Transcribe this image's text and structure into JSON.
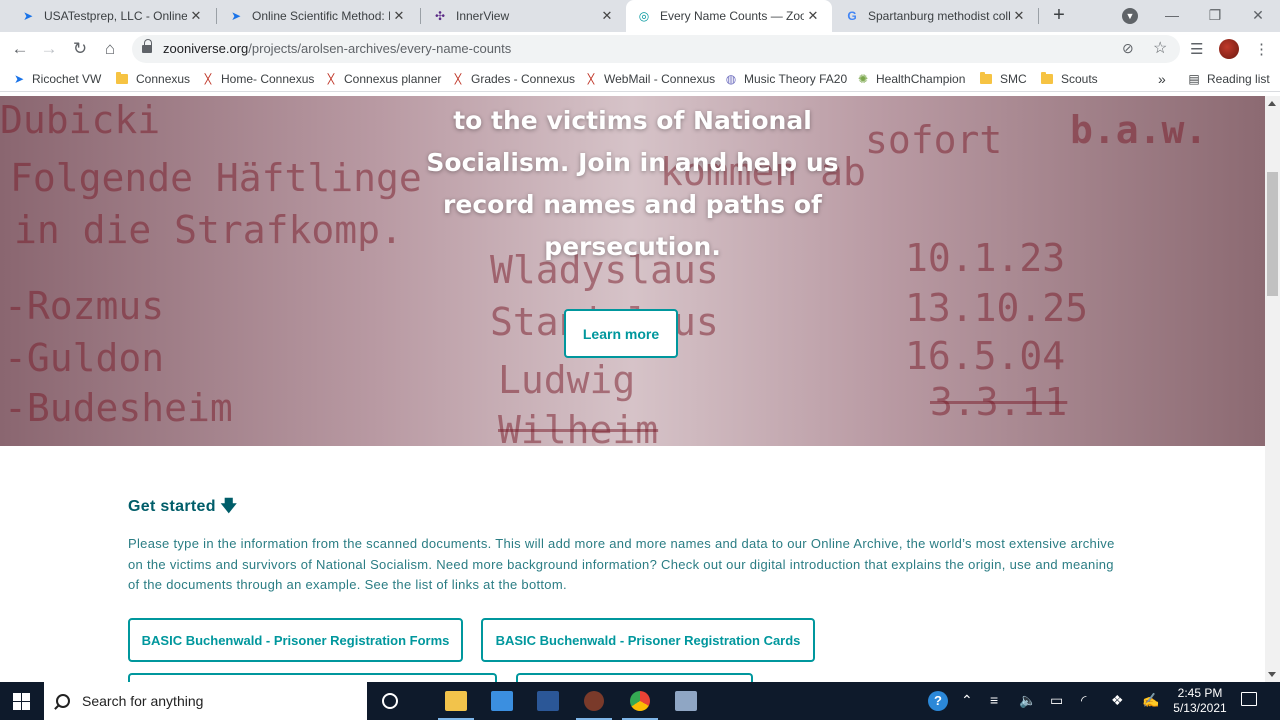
{
  "browser": {
    "tabs": [
      {
        "title": "USATestprep, LLC - Online State",
        "favicon": "cursor-icon"
      },
      {
        "title": "Online Scientific Method: Hypoth",
        "favicon": "cursor-icon"
      },
      {
        "title": "InnerView",
        "favicon": "innerview-icon"
      },
      {
        "title": "Every Name Counts — Zooniverse",
        "favicon": "zooniverse-icon"
      },
      {
        "title": "Spartanburg methodist college",
        "favicon": "google-icon"
      }
    ],
    "url_domain": "zooniverse.org",
    "url_path": "/projects/arolsen-archives/every-name-counts"
  },
  "bookmarks": [
    {
      "label": "Ricochet VW",
      "icon": "cursor-icon"
    },
    {
      "label": "Connexus",
      "icon": "folder-icon"
    },
    {
      "label": "Home- Connexus",
      "icon": "connexus-icon"
    },
    {
      "label": "Connexus planner",
      "icon": "connexus-icon"
    },
    {
      "label": "Grades - Connexus",
      "icon": "connexus-icon"
    },
    {
      "label": "WebMail - Connexus",
      "icon": "connexus-icon"
    },
    {
      "label": "Music Theory FA20",
      "icon": "globe-icon"
    },
    {
      "label": "HealthChampion",
      "icon": "gear-icon"
    },
    {
      "label": "SMC",
      "icon": "folder-icon"
    },
    {
      "label": "Scouts",
      "icon": "folder-icon"
    }
  ],
  "reading_list": "Reading list",
  "more_bookmarks": "»",
  "hero": {
    "line1": "to the victims of National",
    "line2": "Socialism. Join in and help us",
    "line3": "record names and paths of",
    "line4": "persecution.",
    "learn_more": "Learn more",
    "scan_text": {
      "a": "Dubicki",
      "b": "Folgende Häftlinge",
      "c": "in die Strafkomp.",
      "d": "-Rozmus",
      "e": "-Guldon",
      "f": "-Budesheim",
      "g": "kommen ab",
      "h": "sofort",
      "i": "b.a.w.",
      "j": "Wladyslaus",
      "k": "Stanislaus",
      "l": "Ludwig",
      "m": "Wilheim",
      "n": "10.1.23",
      "o": "13.10.25",
      "p": "16.5.04",
      "q": "3.3.11"
    }
  },
  "get_started": {
    "heading": "Get started",
    "arrow": "🡇",
    "text": "Please type in the information from the scanned documents. This will add more and more names and data to our Online Archive, the world’s most extensive archive on the victims and survivors of National Socialism. Need more background information? Check out our digital introduction that explains the origin, use and meaning of the documents through an example. See the list of links at the bottom.",
    "workflow_1": "BASIC Buchenwald - Prisoner Registration Forms",
    "workflow_2": "BASIC Buchenwald - Prisoner Registration Cards"
  },
  "taskbar": {
    "search_placeholder": "Search for anything",
    "time": "2:45 PM",
    "date": "5/13/2021"
  },
  "colors": {
    "accent": "#00979d",
    "heading": "#005d69",
    "taskbar": "#0e1a2b"
  }
}
